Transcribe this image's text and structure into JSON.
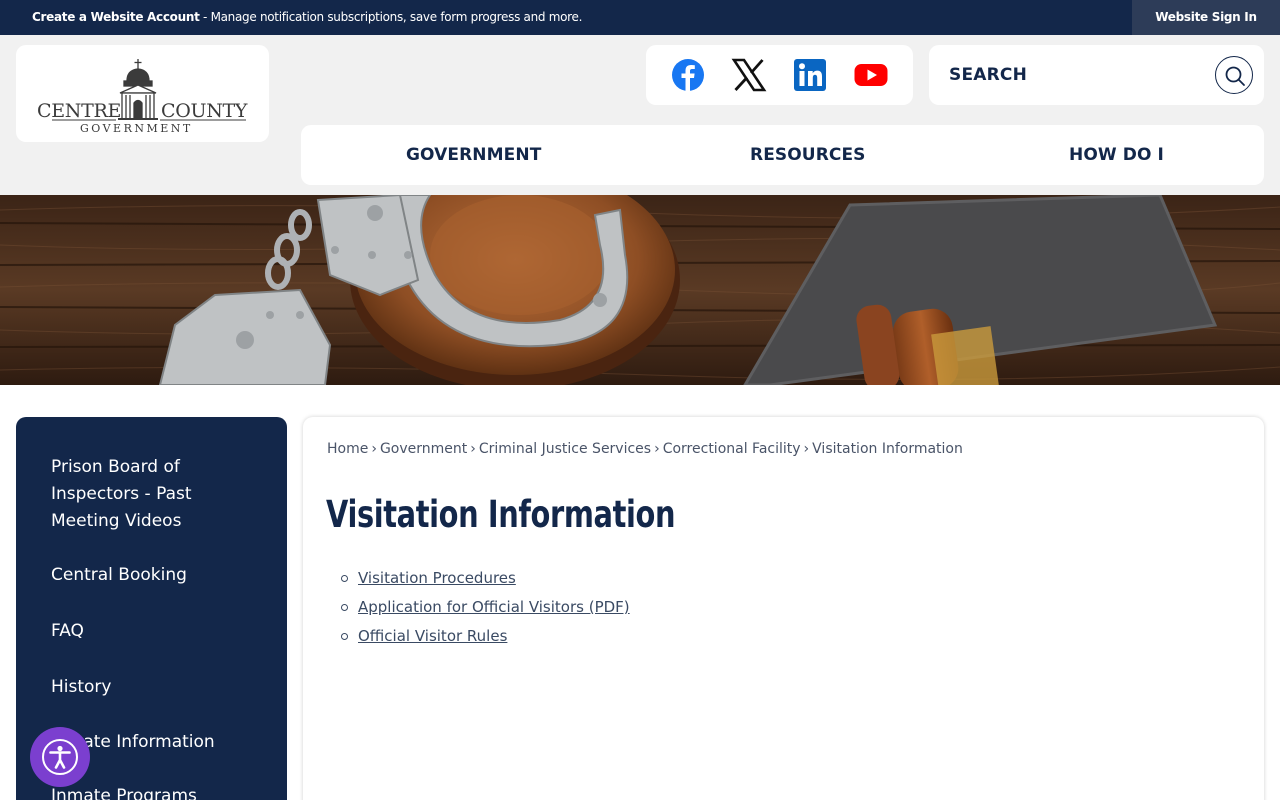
{
  "topbar": {
    "account_link": "Create a Website Account",
    "account_text": " - Manage notification subscriptions, save form progress and more.",
    "signin": "Website Sign In"
  },
  "logo": {
    "line1_left": "CENTRE",
    "line1_right": "COUNTY",
    "line2": "GOVERNMENT"
  },
  "social": {
    "icons": [
      "facebook-icon",
      "x-icon",
      "linkedin-icon",
      "youtube-icon"
    ]
  },
  "search": {
    "placeholder": "SEARCH"
  },
  "nav": {
    "items": [
      "GOVERNMENT",
      "RESOURCES",
      "HOW DO I"
    ]
  },
  "sidebar": {
    "items": [
      "Prison Board of Inspectors - Past Meeting Videos",
      "Central Booking",
      "FAQ",
      "History",
      "Inmate Information",
      "Inmate Programs"
    ]
  },
  "breadcrumb": [
    "Home",
    "Government",
    "Criminal Justice Services",
    "Correctional Facility",
    "Visitation Information"
  ],
  "page": {
    "title": "Visitation Information",
    "links": [
      "Visitation Procedures",
      "Application for Official Visitors (PDF)",
      "Official Visitor Rules"
    ]
  },
  "colors": {
    "navy": "#13274a",
    "accessibility": "#7b3fcf",
    "facebook": "#1877f2",
    "linkedin": "#0a66c2",
    "youtube": "#ff0000"
  }
}
